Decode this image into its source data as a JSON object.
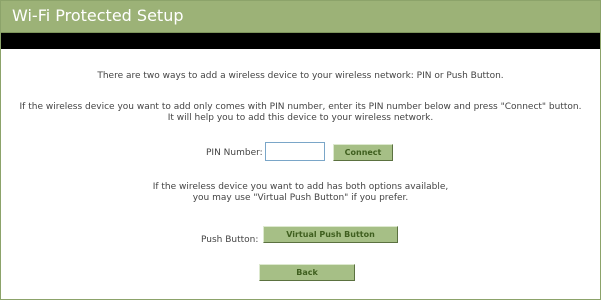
{
  "page": {
    "title": "Wi-Fi Protected Setup"
  },
  "content": {
    "intro": "There are two ways to add a wireless device to your wireless network: PIN or Push Button.",
    "pin_instruction_line1": "If the wireless device you want to add only comes with PIN number, enter its PIN number below and press \"Connect\" button.",
    "pin_instruction_line2": "It will help you to add this device to your wireless network.",
    "pin_label": "PIN Number:",
    "pin_value": "",
    "connect_label": "Connect",
    "push_instruction_line1": "If the wireless device you want to add has both options available,",
    "push_instruction_line2": "you may use \"Virtual Push Button\" if you prefer.",
    "push_label": "Push Button:",
    "virtual_push_label": "Virtual Push Button",
    "back_label": "Back"
  },
  "colors": {
    "title_bar": "#9cb277",
    "title_text": "#ffffff",
    "band": "#000000",
    "button_bg": "#a6bf86",
    "button_text": "#3f5f1f",
    "body_text": "#444444",
    "input_border": "#7aa6c8"
  }
}
